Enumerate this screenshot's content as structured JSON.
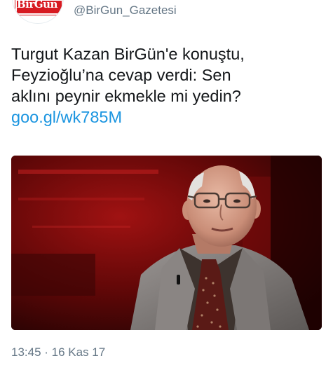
{
  "account": {
    "avatar_logo_text": "BirGün",
    "handle": "@BirGun_Gazetesi"
  },
  "tweet": {
    "lines": [
      "Turgut Kazan BirGün'e konuştu,",
      "Feyzioğlu’na cevap verdi: Sen",
      "aklını peynir ekmekle mi yedin?"
    ],
    "link": "goo.gl/wk785M",
    "media_description_icon": "photo-icon"
  },
  "meta": {
    "timestamp": "13:45 · 16 Kas 17"
  },
  "colors": {
    "text": "#14171a",
    "secondary": "#657786",
    "link": "#1b95e0",
    "brand_red": "#d71a21",
    "studio_red": "#8e0c0c"
  }
}
